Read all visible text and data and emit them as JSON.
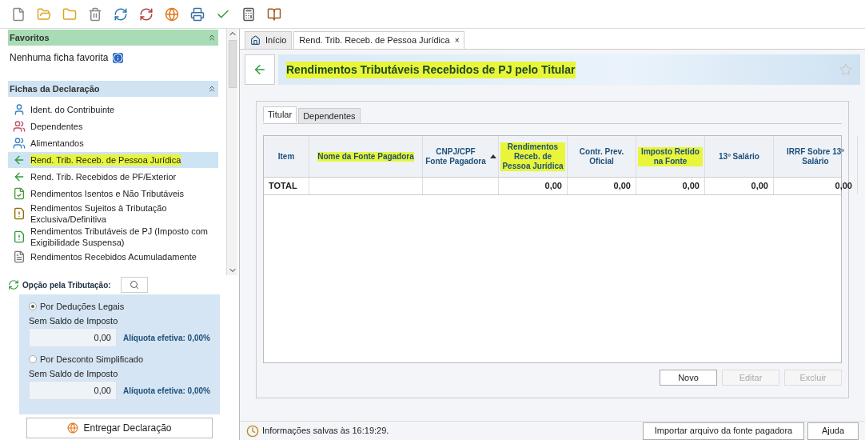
{
  "favorites": {
    "title": "Favoritos",
    "empty_text": "Nenhuma ficha favorita"
  },
  "fichas": {
    "title": "Fichas da Declaração",
    "items": [
      {
        "label": "Ident. do Contribuinte",
        "kind": "person",
        "selected": false,
        "highlighted": false
      },
      {
        "label": "Dependentes",
        "kind": "people",
        "selected": false,
        "highlighted": false
      },
      {
        "label": "Alimentandos",
        "kind": "group",
        "selected": false,
        "highlighted": false
      },
      {
        "label": "Rend. Trib. Receb. de Pessoa Jurídica",
        "kind": "arrow",
        "selected": true,
        "highlighted": true
      },
      {
        "label": "Rend. Trib. Recebidos de PF/Exterior",
        "kind": "arrow",
        "selected": false,
        "highlighted": false
      },
      {
        "label": "Rendimentos Isentos e Não Tributáveis",
        "kind": "doc-check",
        "selected": false,
        "highlighted": false
      },
      {
        "label": "Rendimentos Sujeitos à Tributação Exclusiva/Definitiva",
        "kind": "doc-warn",
        "selected": false,
        "highlighted": false
      },
      {
        "label": "Rendimentos Tributáveis de PJ (Imposto com Exigibilidade Suspensa)",
        "kind": "arrow-warn",
        "selected": false,
        "highlighted": false
      },
      {
        "label": "Rendimentos Recebidos Acumuladamente",
        "kind": "doc",
        "selected": false,
        "highlighted": false
      }
    ]
  },
  "tributacao": {
    "title": "Opção pela Tributação:",
    "options": [
      {
        "label": "Por Deduções Legais",
        "selected": true,
        "caption": "Sem Saldo de Imposto",
        "value": "0,00",
        "aliquota": "Alíquota efetiva: 0,00%"
      },
      {
        "label": "Por Desconto Simplificado",
        "selected": false,
        "caption": "Sem Saldo de Imposto",
        "value": "0,00",
        "aliquota": "Alíquota efetiva: 0,00%"
      }
    ],
    "submit": "Entregar Declaração"
  },
  "tabs": [
    {
      "label": "Início",
      "selected": false,
      "closable": false
    },
    {
      "label": "Rend. Trib. Receb. de Pessoa Jurídica",
      "selected": true,
      "closable": true,
      "close": "×"
    }
  ],
  "page_title": {
    "text": "Rendimentos Tributáveis Recebidos de PJ pelo Titular",
    "highlighted": true
  },
  "subtabs": [
    {
      "label": "Titular",
      "selected": true
    },
    {
      "label": "Dependentes",
      "selected": false
    }
  ],
  "table": {
    "columns": [
      {
        "label": "Item",
        "highlighted": false,
        "sorted": false
      },
      {
        "label": "Nome da Fonte Pagadora",
        "highlighted": true,
        "sorted": false
      },
      {
        "label": "CNPJ/CPF Fonte Pagadora",
        "highlighted": false,
        "sorted": true
      },
      {
        "label": "Rendimentos Receb. de Pessoa Jurídica",
        "highlighted": true,
        "sorted": false
      },
      {
        "label": "Contr. Prev. Oficial",
        "highlighted": false,
        "sorted": false
      },
      {
        "label": "Imposto Retido na Fonte",
        "highlighted": true,
        "sorted": false
      },
      {
        "label": "13º Salário",
        "highlighted": false,
        "sorted": false
      },
      {
        "label": "IRRF Sobre 13º Salário",
        "highlighted": false,
        "sorted": false
      }
    ],
    "total_row": {
      "label": "TOTAL",
      "values": [
        "0,00",
        "0,00",
        "0,00",
        "0,00",
        "0,00"
      ]
    }
  },
  "buttons": [
    {
      "label": "Novo",
      "disabled": false
    },
    {
      "label": "Editar",
      "disabled": true
    },
    {
      "label": "Excluir",
      "disabled": true
    }
  ],
  "status": "Informações salvas às 16:19:29.",
  "footer_buttons": [
    "Importar arquivo da fonte pagadora",
    "Ajuda"
  ]
}
